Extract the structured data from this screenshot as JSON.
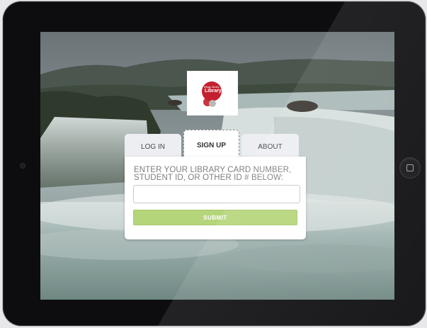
{
  "brand": {
    "logo_small_text": "Kitsap Library",
    "logo_text": "Library",
    "logo_color": "#c4202f"
  },
  "tabs": [
    {
      "label": "LOG IN",
      "active": false
    },
    {
      "label": "SIGN UP",
      "active": true
    },
    {
      "label": "ABOUT",
      "active": false
    }
  ],
  "form": {
    "prompt_line1": "ENTER YOUR LIBRARY CARD NUMBER,",
    "prompt_line2": "STUDENT ID, OR OTHER ID # BELOW:",
    "id_value": "",
    "submit_label": "SUBMIT",
    "submit_color": "#b5d57a"
  },
  "device": {
    "home_button_icon": "home-square-icon",
    "camera_icon": "camera-icon"
  }
}
